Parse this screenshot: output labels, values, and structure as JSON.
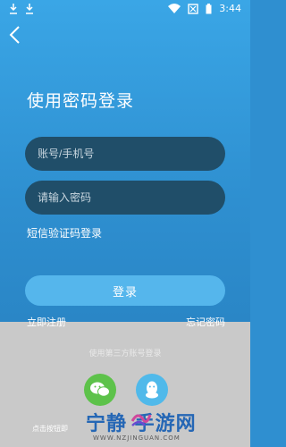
{
  "status_bar": {
    "time": "3:44"
  },
  "login": {
    "title": "使用密码登录",
    "account_placeholder": "账号/手机号",
    "password_placeholder": "请输入密码",
    "sms_login": "短信验证码登录",
    "login_button": "登录",
    "register": "立即注册",
    "forgot": "忘记密码"
  },
  "third_party": {
    "label": "使用第三方账号登录",
    "icons": [
      "wechat-icon",
      "qq-icon"
    ],
    "tip": "点击按钮即"
  },
  "watermark": {
    "text": "宁静 手游网",
    "url": "WWW.NZJINGUAN.COM"
  },
  "colors": {
    "accent": "#55b6ec",
    "input_bg": "#204e69",
    "wechat": "#5dc24a",
    "qq": "#50b9ea"
  }
}
